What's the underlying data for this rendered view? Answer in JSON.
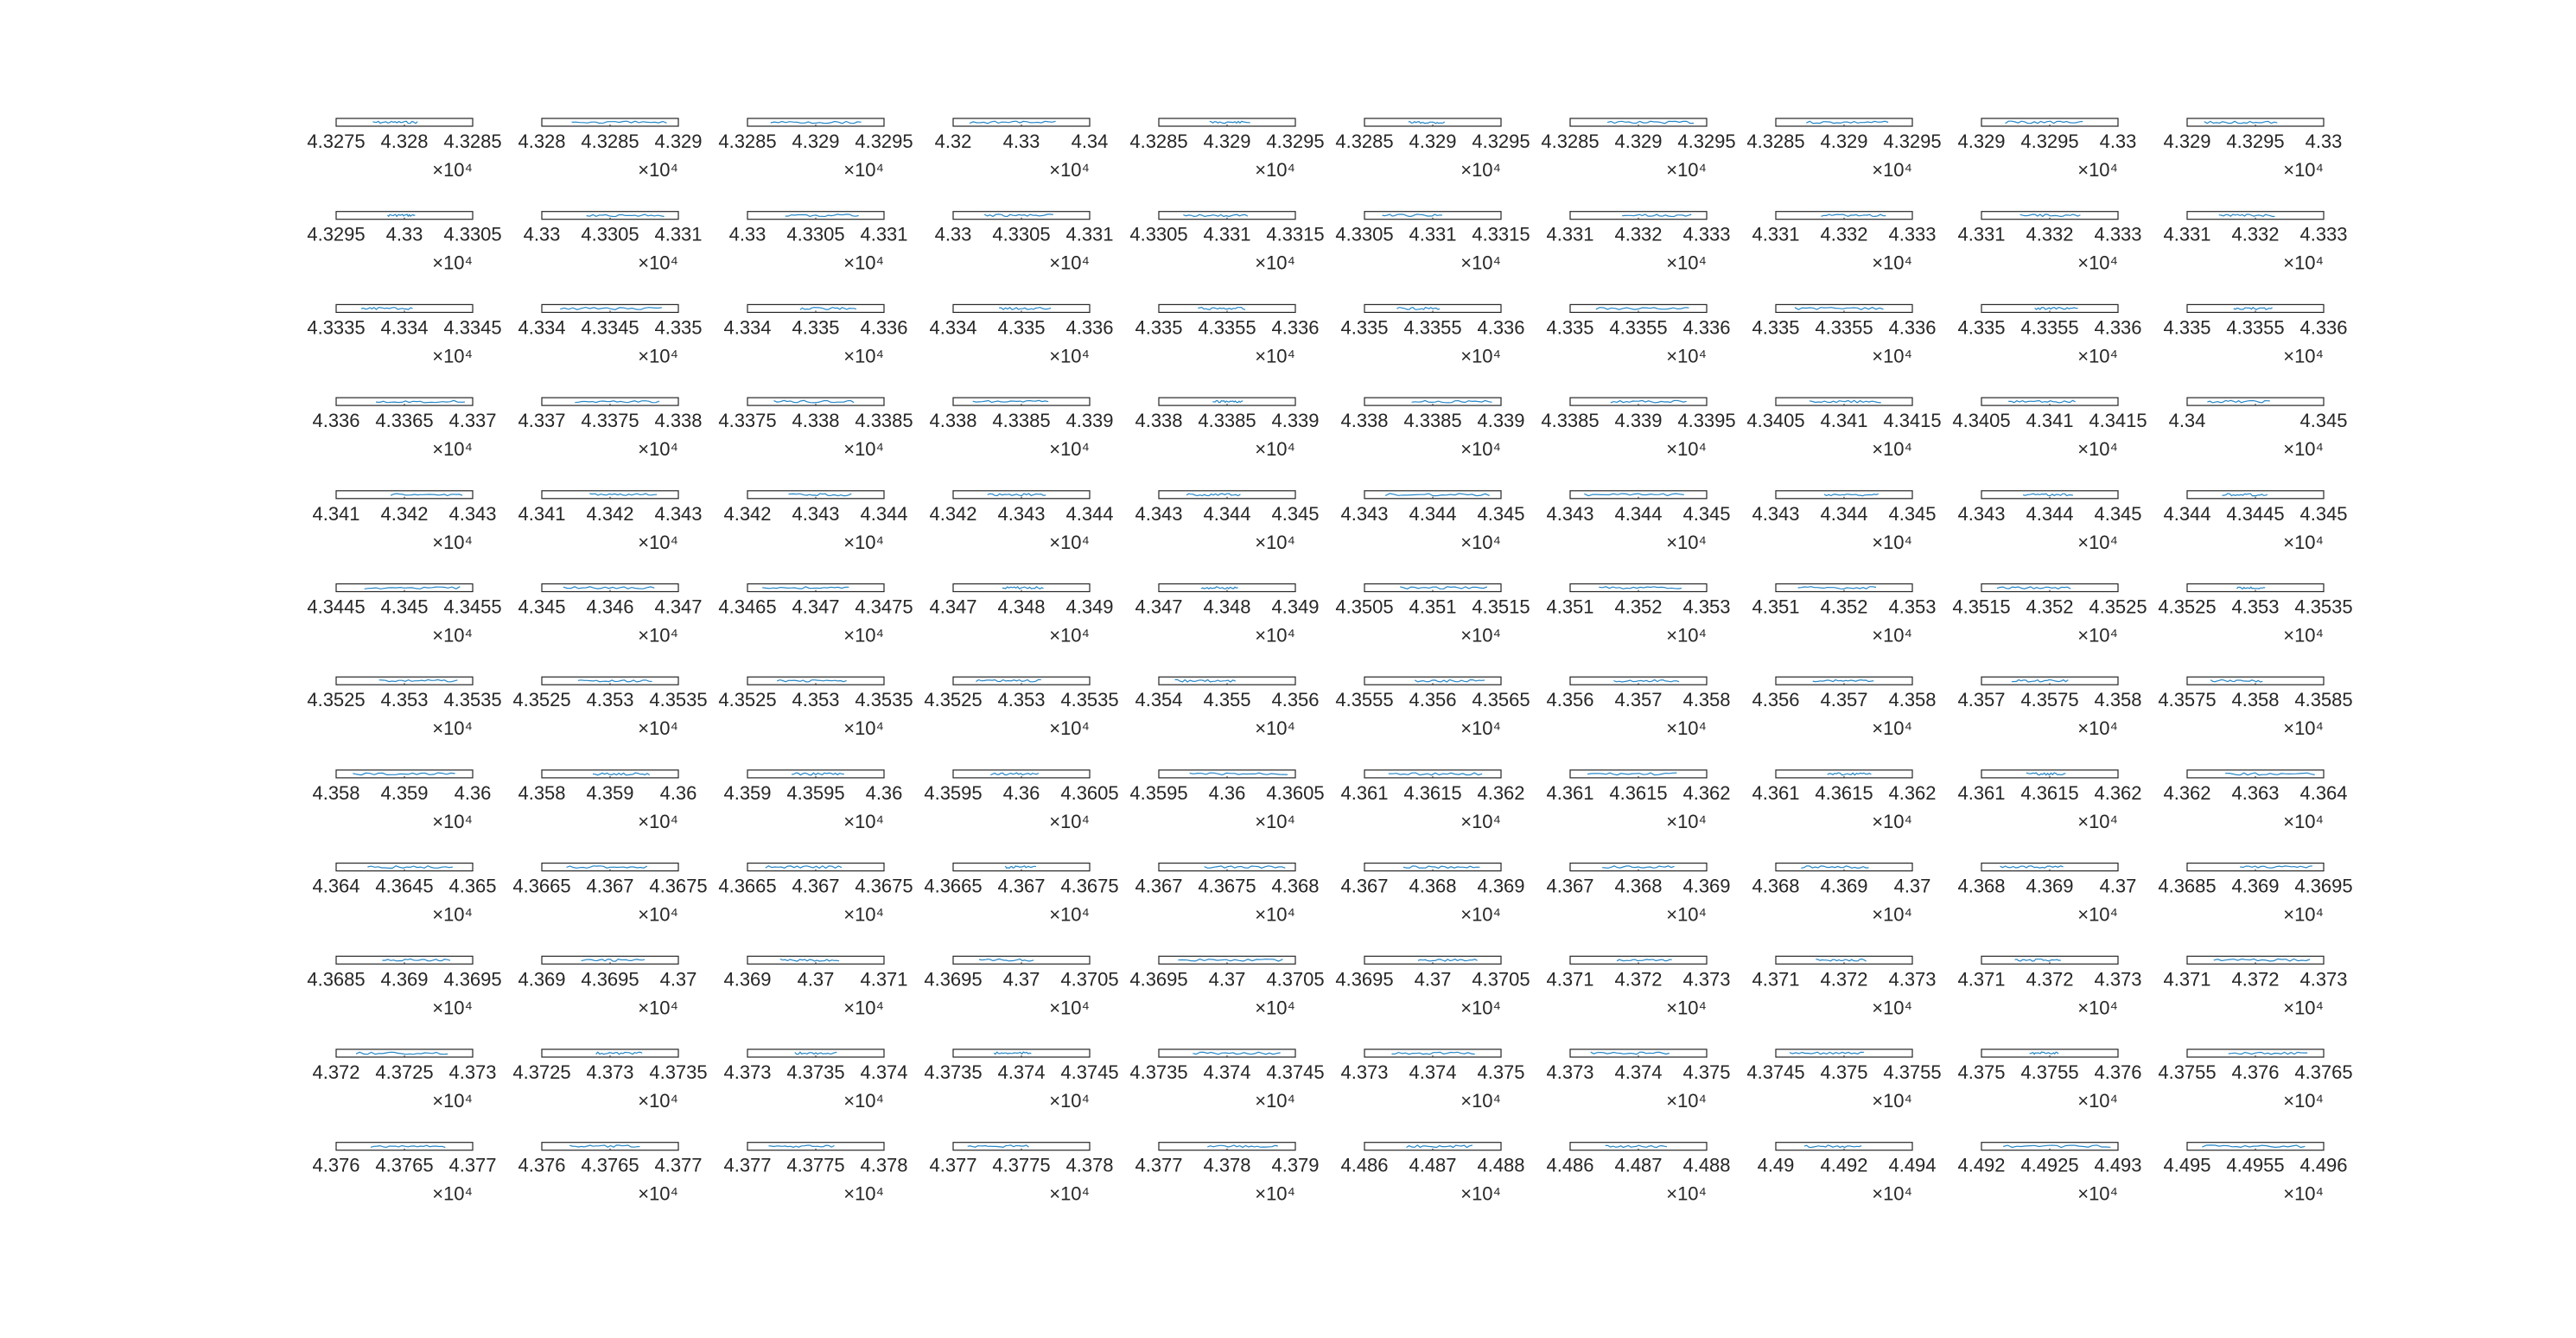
{
  "figure": {
    "background": "#ffffff",
    "axis_color": "#262626",
    "line_color": "#0072bd"
  },
  "chart_data": {
    "type": "line",
    "layout": "grid of small-multiple line plots, 12 rows x 10 columns",
    "exponent_label": "×10⁴",
    "grid": false,
    "legend": "none",
    "panels": [
      {
        "ticks": [
          "4.3275",
          "4.328",
          "4.3285"
        ]
      },
      {
        "ticks": [
          "4.328",
          "4.3285",
          "4.329"
        ]
      },
      {
        "ticks": [
          "4.3285",
          "4.329",
          "4.3295"
        ]
      },
      {
        "ticks": [
          "4.32",
          "4.33",
          "4.34"
        ]
      },
      {
        "ticks": [
          "4.3285",
          "4.329",
          "4.3295"
        ]
      },
      {
        "ticks": [
          "4.3285",
          "4.329",
          "4.3295"
        ]
      },
      {
        "ticks": [
          "4.3285",
          "4.329",
          "4.3295"
        ]
      },
      {
        "ticks": [
          "4.3285",
          "4.329",
          "4.3295"
        ]
      },
      {
        "ticks": [
          "4.329",
          "4.3295",
          "4.33"
        ]
      },
      {
        "ticks": [
          "4.329",
          "4.3295",
          "4.33"
        ]
      },
      {
        "ticks": [
          "4.3295",
          "4.33",
          "4.3305"
        ]
      },
      {
        "ticks": [
          "4.33",
          "4.3305",
          "4.331"
        ]
      },
      {
        "ticks": [
          "4.33",
          "4.3305",
          "4.331"
        ]
      },
      {
        "ticks": [
          "4.33",
          "4.3305",
          "4.331"
        ]
      },
      {
        "ticks": [
          "4.3305",
          "4.331",
          "4.3315"
        ]
      },
      {
        "ticks": [
          "4.3305",
          "4.331",
          "4.3315"
        ]
      },
      {
        "ticks": [
          "4.331",
          "4.332",
          "4.333"
        ]
      },
      {
        "ticks": [
          "4.331",
          "4.332",
          "4.333"
        ]
      },
      {
        "ticks": [
          "4.331",
          "4.332",
          "4.333"
        ]
      },
      {
        "ticks": [
          "4.331",
          "4.332",
          "4.333"
        ]
      },
      {
        "ticks": [
          "4.3335",
          "4.334",
          "4.3345"
        ]
      },
      {
        "ticks": [
          "4.334",
          "4.3345",
          "4.335"
        ]
      },
      {
        "ticks": [
          "4.334",
          "4.335",
          "4.336"
        ]
      },
      {
        "ticks": [
          "4.334",
          "4.335",
          "4.336"
        ]
      },
      {
        "ticks": [
          "4.335",
          "4.3355",
          "4.336"
        ]
      },
      {
        "ticks": [
          "4.335",
          "4.3355",
          "4.336"
        ]
      },
      {
        "ticks": [
          "4.335",
          "4.3355",
          "4.336"
        ]
      },
      {
        "ticks": [
          "4.335",
          "4.3355",
          "4.336"
        ]
      },
      {
        "ticks": [
          "4.335",
          "4.3355",
          "4.336"
        ]
      },
      {
        "ticks": [
          "4.335",
          "4.3355",
          "4.336"
        ]
      },
      {
        "ticks": [
          "4.336",
          "4.3365",
          "4.337"
        ]
      },
      {
        "ticks": [
          "4.337",
          "4.3375",
          "4.338"
        ]
      },
      {
        "ticks": [
          "4.3375",
          "4.338",
          "4.3385"
        ]
      },
      {
        "ticks": [
          "4.338",
          "4.3385",
          "4.339"
        ]
      },
      {
        "ticks": [
          "4.338",
          "4.3385",
          "4.339"
        ]
      },
      {
        "ticks": [
          "4.338",
          "4.3385",
          "4.339"
        ]
      },
      {
        "ticks": [
          "4.3385",
          "4.339",
          "4.3395"
        ]
      },
      {
        "ticks": [
          "4.3405",
          "4.341",
          "4.3415"
        ]
      },
      {
        "ticks": [
          "4.3405",
          "4.341",
          "4.3415"
        ]
      },
      {
        "ticks": [
          "4.34",
          "",
          "4.345"
        ]
      },
      {
        "ticks": [
          "4.341",
          "4.342",
          "4.343"
        ]
      },
      {
        "ticks": [
          "4.341",
          "4.342",
          "4.343"
        ]
      },
      {
        "ticks": [
          "4.342",
          "4.343",
          "4.344"
        ]
      },
      {
        "ticks": [
          "4.342",
          "4.343",
          "4.344"
        ]
      },
      {
        "ticks": [
          "4.343",
          "4.344",
          "4.345"
        ]
      },
      {
        "ticks": [
          "4.343",
          "4.344",
          "4.345"
        ]
      },
      {
        "ticks": [
          "4.343",
          "4.344",
          "4.345"
        ]
      },
      {
        "ticks": [
          "4.343",
          "4.344",
          "4.345"
        ]
      },
      {
        "ticks": [
          "4.343",
          "4.344",
          "4.345"
        ]
      },
      {
        "ticks": [
          "4.344",
          "4.3445",
          "4.345"
        ]
      },
      {
        "ticks": [
          "4.3445",
          "4.345",
          "4.3455"
        ]
      },
      {
        "ticks": [
          "4.345",
          "4.346",
          "4.347"
        ]
      },
      {
        "ticks": [
          "4.3465",
          "4.347",
          "4.3475"
        ]
      },
      {
        "ticks": [
          "4.347",
          "4.348",
          "4.349"
        ]
      },
      {
        "ticks": [
          "4.347",
          "4.348",
          "4.349"
        ]
      },
      {
        "ticks": [
          "4.3505",
          "4.351",
          "4.3515"
        ]
      },
      {
        "ticks": [
          "4.351",
          "4.352",
          "4.353"
        ]
      },
      {
        "ticks": [
          "4.351",
          "4.352",
          "4.353"
        ]
      },
      {
        "ticks": [
          "4.3515",
          "4.352",
          "4.3525"
        ]
      },
      {
        "ticks": [
          "4.3525",
          "4.353",
          "4.3535"
        ]
      },
      {
        "ticks": [
          "4.3525",
          "4.353",
          "4.3535"
        ]
      },
      {
        "ticks": [
          "4.3525",
          "4.353",
          "4.3535"
        ]
      },
      {
        "ticks": [
          "4.3525",
          "4.353",
          "4.3535"
        ]
      },
      {
        "ticks": [
          "4.3525",
          "4.353",
          "4.3535"
        ]
      },
      {
        "ticks": [
          "4.354",
          "4.355",
          "4.356"
        ]
      },
      {
        "ticks": [
          "4.3555",
          "4.356",
          "4.3565"
        ]
      },
      {
        "ticks": [
          "4.356",
          "4.357",
          "4.358"
        ]
      },
      {
        "ticks": [
          "4.356",
          "4.357",
          "4.358"
        ]
      },
      {
        "ticks": [
          "4.357",
          "4.3575",
          "4.358"
        ]
      },
      {
        "ticks": [
          "4.3575",
          "4.358",
          "4.3585"
        ]
      },
      {
        "ticks": [
          "4.358",
          "4.359",
          "4.36"
        ]
      },
      {
        "ticks": [
          "4.358",
          "4.359",
          "4.36"
        ]
      },
      {
        "ticks": [
          "4.359",
          "4.3595",
          "4.36"
        ]
      },
      {
        "ticks": [
          "4.3595",
          "4.36",
          "4.3605"
        ]
      },
      {
        "ticks": [
          "4.3595",
          "4.36",
          "4.3605"
        ]
      },
      {
        "ticks": [
          "4.361",
          "4.3615",
          "4.362"
        ]
      },
      {
        "ticks": [
          "4.361",
          "4.3615",
          "4.362"
        ]
      },
      {
        "ticks": [
          "4.361",
          "4.3615",
          "4.362"
        ]
      },
      {
        "ticks": [
          "4.361",
          "4.3615",
          "4.362"
        ]
      },
      {
        "ticks": [
          "4.362",
          "4.363",
          "4.364"
        ]
      },
      {
        "ticks": [
          "4.364",
          "4.3645",
          "4.365"
        ]
      },
      {
        "ticks": [
          "4.3665",
          "4.367",
          "4.3675"
        ]
      },
      {
        "ticks": [
          "4.3665",
          "4.367",
          "4.3675"
        ]
      },
      {
        "ticks": [
          "4.3665",
          "4.367",
          "4.3675"
        ]
      },
      {
        "ticks": [
          "4.367",
          "4.3675",
          "4.368"
        ]
      },
      {
        "ticks": [
          "4.367",
          "4.368",
          "4.369"
        ]
      },
      {
        "ticks": [
          "4.367",
          "4.368",
          "4.369"
        ]
      },
      {
        "ticks": [
          "4.368",
          "4.369",
          "4.37"
        ]
      },
      {
        "ticks": [
          "4.368",
          "4.369",
          "4.37"
        ]
      },
      {
        "ticks": [
          "4.3685",
          "4.369",
          "4.3695"
        ]
      },
      {
        "ticks": [
          "4.3685",
          "4.369",
          "4.3695"
        ]
      },
      {
        "ticks": [
          "4.369",
          "4.3695",
          "4.37"
        ]
      },
      {
        "ticks": [
          "4.369",
          "4.37",
          "4.371"
        ]
      },
      {
        "ticks": [
          "4.3695",
          "4.37",
          "4.3705"
        ]
      },
      {
        "ticks": [
          "4.3695",
          "4.37",
          "4.3705"
        ]
      },
      {
        "ticks": [
          "4.3695",
          "4.37",
          "4.3705"
        ]
      },
      {
        "ticks": [
          "4.371",
          "4.372",
          "4.373"
        ]
      },
      {
        "ticks": [
          "4.371",
          "4.372",
          "4.373"
        ]
      },
      {
        "ticks": [
          "4.371",
          "4.372",
          "4.373"
        ]
      },
      {
        "ticks": [
          "4.371",
          "4.372",
          "4.373"
        ]
      },
      {
        "ticks": [
          "4.372",
          "4.3725",
          "4.373"
        ]
      },
      {
        "ticks": [
          "4.3725",
          "4.373",
          "4.3735"
        ]
      },
      {
        "ticks": [
          "4.373",
          "4.3735",
          "4.374"
        ]
      },
      {
        "ticks": [
          "4.3735",
          "4.374",
          "4.3745"
        ]
      },
      {
        "ticks": [
          "4.3735",
          "4.374",
          "4.3745"
        ]
      },
      {
        "ticks": [
          "4.373",
          "4.374",
          "4.375"
        ]
      },
      {
        "ticks": [
          "4.373",
          "4.374",
          "4.375"
        ]
      },
      {
        "ticks": [
          "4.3745",
          "4.375",
          "4.3755"
        ]
      },
      {
        "ticks": [
          "4.375",
          "4.3755",
          "4.376"
        ]
      },
      {
        "ticks": [
          "4.3755",
          "4.376",
          "4.3765"
        ]
      },
      {
        "ticks": [
          "4.376",
          "4.3765",
          "4.377"
        ]
      },
      {
        "ticks": [
          "4.376",
          "4.3765",
          "4.377"
        ]
      },
      {
        "ticks": [
          "4.377",
          "4.3775",
          "4.378"
        ]
      },
      {
        "ticks": [
          "4.377",
          "4.3775",
          "4.378"
        ]
      },
      {
        "ticks": [
          "4.377",
          "4.378",
          "4.379"
        ]
      },
      {
        "ticks": [
          "4.486",
          "4.487",
          "4.488"
        ]
      },
      {
        "ticks": [
          "4.486",
          "4.487",
          "4.488"
        ]
      },
      {
        "ticks": [
          "4.49",
          "4.492",
          "4.494"
        ]
      },
      {
        "ticks": [
          "4.492",
          "4.4925",
          "4.493"
        ]
      },
      {
        "ticks": [
          "4.495",
          "4.4955",
          "4.496"
        ]
      }
    ]
  }
}
